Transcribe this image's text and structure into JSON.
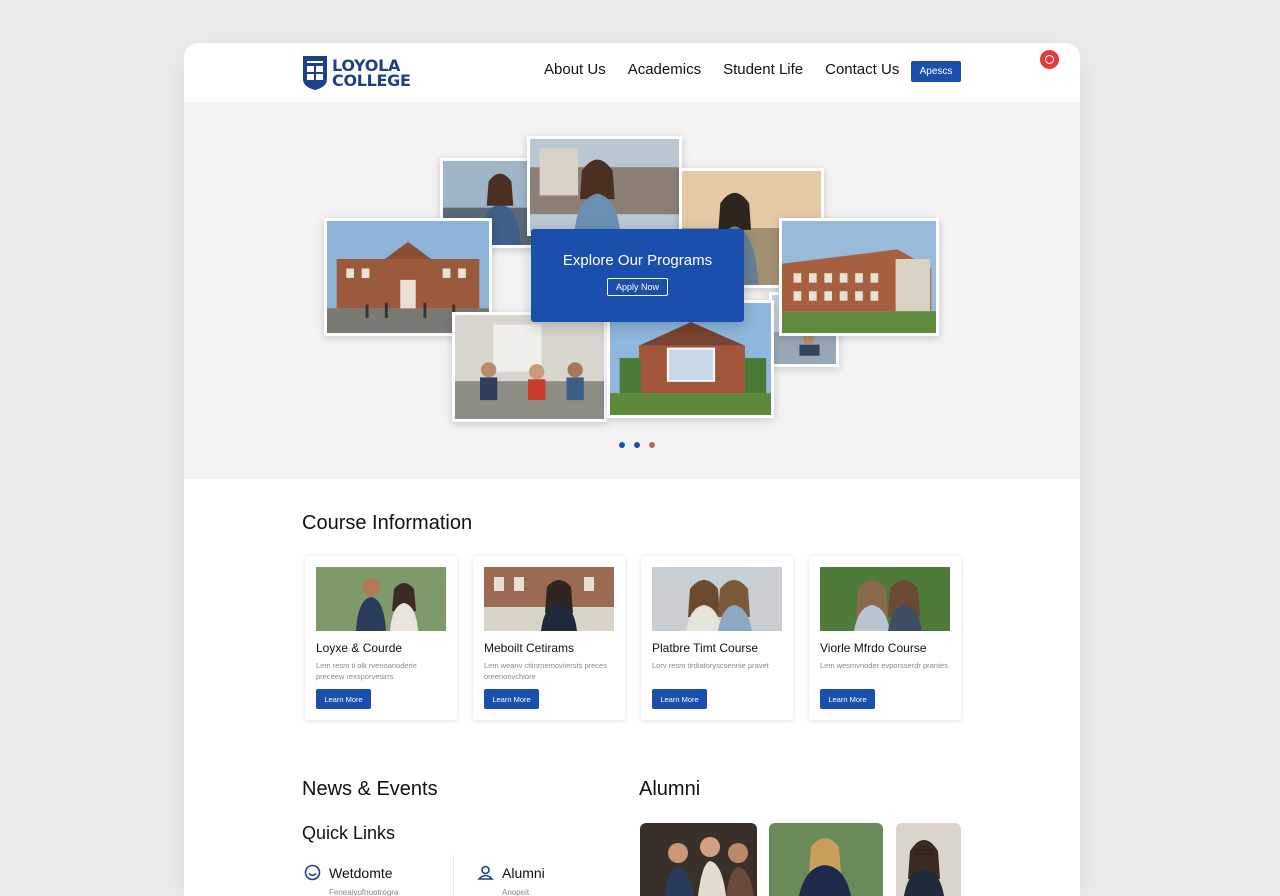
{
  "header": {
    "logo_line1": "LOYOLA",
    "logo_line2": "COLLEGE",
    "nav": [
      "About Us",
      "Academics",
      "Student Life",
      "Contact Us"
    ],
    "cta": "Apescs"
  },
  "hero": {
    "title": "Explore Our Programs",
    "button": "Apply Now",
    "carousel_dots": 3
  },
  "courses": {
    "title": "Course Information",
    "items": [
      {
        "title": "Loyxe & Courde",
        "desc": "Lem resm ti olk rvenoanoderie preceew rexsporvesirrs",
        "button": "Learn More"
      },
      {
        "title": "Meboilt Cetirams",
        "desc": "Lem weanv ctiinrnemoviiersts preces oreenonvchiore",
        "button": "Learn More"
      },
      {
        "title": "Platbre Timt Course",
        "desc": "Lorv resm tirdiatoryscsennie pravet",
        "button": "Learn More"
      },
      {
        "title": "Viorle Mfrdo Course",
        "desc": "Lem wesmvnoder evporsserdr prantes",
        "button": "Learn More"
      }
    ]
  },
  "news": {
    "title": "News & Events"
  },
  "quick_links": {
    "title": "Quick Links",
    "items": [
      {
        "label": "Wetdomte",
        "sub": "Feneaivufnuotrogra",
        "icon": "smile-icon"
      },
      {
        "label": "Alumni",
        "sub": "Anopeit",
        "icon": "badge-icon"
      }
    ]
  },
  "alumni": {
    "title": "Alumni"
  },
  "colors": {
    "brand": "#1a4fae",
    "record": "#e23b3b"
  }
}
